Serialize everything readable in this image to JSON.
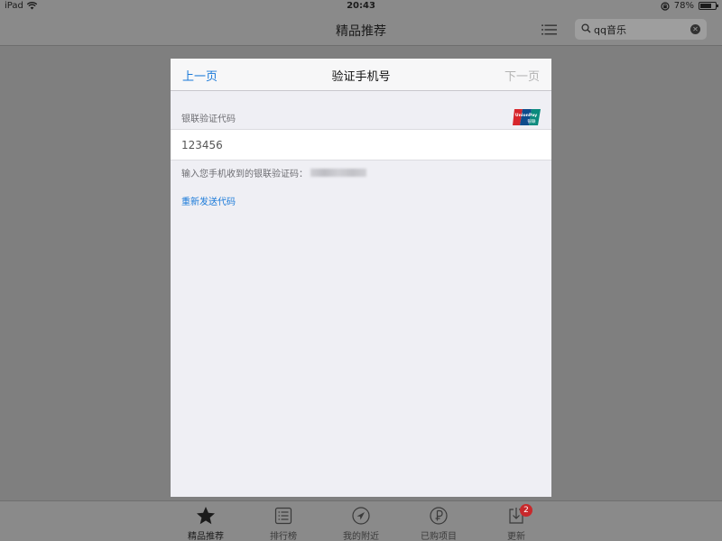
{
  "status_bar": {
    "device": "iPad",
    "time": "20:43",
    "battery": "78%",
    "battery_fraction": 0.78
  },
  "nav_bar": {
    "title": "精品推荐",
    "search_value": "qq音乐"
  },
  "modal": {
    "prev_label": "上一页",
    "title": "验证手机号",
    "next_label": "下一页",
    "section_label": "银联验证代码",
    "code_value": "123456",
    "hint": "输入您手机收到的银联验证码：",
    "resend": "重新发送代码",
    "logo": {
      "text_top": "UnionPay",
      "text_bottom": "银联"
    }
  },
  "tab_bar": {
    "tabs": [
      {
        "label": "精品推荐",
        "icon": "star-icon"
      },
      {
        "label": "排行榜",
        "icon": "list-icon"
      },
      {
        "label": "我的附近",
        "icon": "location-icon"
      },
      {
        "label": "已购项目",
        "icon": "purchased-icon"
      },
      {
        "label": "更新",
        "icon": "updates-icon"
      }
    ],
    "updates_badge": "2"
  }
}
